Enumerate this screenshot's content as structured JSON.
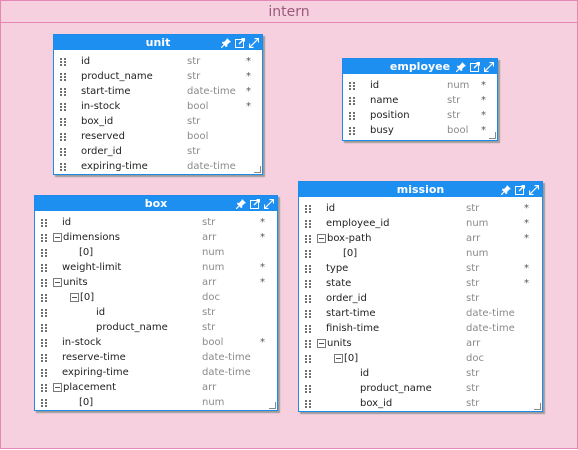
{
  "container": {
    "title": "intern"
  },
  "entities": {
    "unit": {
      "title": "unit",
      "fields": [
        {
          "name": "id",
          "type": "str",
          "req": "*"
        },
        {
          "name": "product_name",
          "type": "str",
          "req": "*"
        },
        {
          "name": "start-time",
          "type": "date-time",
          "req": "*"
        },
        {
          "name": "in-stock",
          "type": "bool",
          "req": "*"
        },
        {
          "name": "box_id",
          "type": "str",
          "req": ""
        },
        {
          "name": "reserved",
          "type": "bool",
          "req": ""
        },
        {
          "name": "order_id",
          "type": "str",
          "req": ""
        },
        {
          "name": "expiring-time",
          "type": "date-time",
          "req": ""
        }
      ]
    },
    "employee": {
      "title": "employee",
      "fields": [
        {
          "name": "id",
          "type": "num",
          "req": "*"
        },
        {
          "name": "name",
          "type": "str",
          "req": "*"
        },
        {
          "name": "position",
          "type": "str",
          "req": "*"
        },
        {
          "name": "busy",
          "type": "bool",
          "req": "*"
        }
      ]
    },
    "box": {
      "title": "box",
      "fields": [
        {
          "name": "id",
          "type": "str",
          "req": "*",
          "level": 0,
          "toggle": false
        },
        {
          "name": "dimensions",
          "type": "arr",
          "req": "*",
          "level": 0,
          "toggle": true
        },
        {
          "name": "[0]",
          "type": "num",
          "req": "",
          "level": 1,
          "toggle": false
        },
        {
          "name": "weight-limit",
          "type": "num",
          "req": "*",
          "level": 0,
          "toggle": false
        },
        {
          "name": "units",
          "type": "arr",
          "req": "*",
          "level": 0,
          "toggle": true
        },
        {
          "name": "[0]",
          "type": "doc",
          "req": "",
          "level": 1,
          "toggle": true
        },
        {
          "name": "id",
          "type": "str",
          "req": "",
          "level": 2,
          "toggle": false
        },
        {
          "name": "product_name",
          "type": "str",
          "req": "",
          "level": 2,
          "toggle": false
        },
        {
          "name": "in-stock",
          "type": "bool",
          "req": "*",
          "level": 0,
          "toggle": false
        },
        {
          "name": "reserve-time",
          "type": "date-time",
          "req": "",
          "level": 0,
          "toggle": false
        },
        {
          "name": "expiring-time",
          "type": "date-time",
          "req": "",
          "level": 0,
          "toggle": false
        },
        {
          "name": "placement",
          "type": "arr",
          "req": "",
          "level": 0,
          "toggle": true
        },
        {
          "name": "[0]",
          "type": "num",
          "req": "",
          "level": 1,
          "toggle": false
        }
      ]
    },
    "mission": {
      "title": "mission",
      "fields": [
        {
          "name": "id",
          "type": "str",
          "req": "*",
          "level": 0,
          "toggle": false
        },
        {
          "name": "employee_id",
          "type": "num",
          "req": "*",
          "level": 0,
          "toggle": false
        },
        {
          "name": "box-path",
          "type": "arr",
          "req": "*",
          "level": 0,
          "toggle": true
        },
        {
          "name": "[0]",
          "type": "num",
          "req": "",
          "level": 1,
          "toggle": false
        },
        {
          "name": "type",
          "type": "str",
          "req": "*",
          "level": 0,
          "toggle": false
        },
        {
          "name": "state",
          "type": "str",
          "req": "*",
          "level": 0,
          "toggle": false
        },
        {
          "name": "order_id",
          "type": "str",
          "req": "",
          "level": 0,
          "toggle": false
        },
        {
          "name": "start-time",
          "type": "date-time",
          "req": "",
          "level": 0,
          "toggle": false
        },
        {
          "name": "finish-time",
          "type": "date-time",
          "req": "",
          "level": 0,
          "toggle": false
        },
        {
          "name": "units",
          "type": "arr",
          "req": "",
          "level": 0,
          "toggle": true
        },
        {
          "name": "[0]",
          "type": "doc",
          "req": "",
          "level": 1,
          "toggle": true
        },
        {
          "name": "id",
          "type": "str",
          "req": "",
          "level": 2,
          "toggle": false
        },
        {
          "name": "product_name",
          "type": "str",
          "req": "",
          "level": 2,
          "toggle": false
        },
        {
          "name": "box_id",
          "type": "str",
          "req": "",
          "level": 2,
          "toggle": false
        }
      ]
    }
  },
  "icons": {
    "pin": "pin-icon",
    "edit": "edit-icon",
    "expand": "expand-icon",
    "grip": "drag-handle-icon",
    "toggle": "collapse-toggle-icon"
  },
  "colors": {
    "header": "#1c8ff0",
    "border": "#1f8ae8",
    "container_bg": "#f7d0e0",
    "container_border": "#e489b4",
    "type_text": "#8a8a8a"
  }
}
